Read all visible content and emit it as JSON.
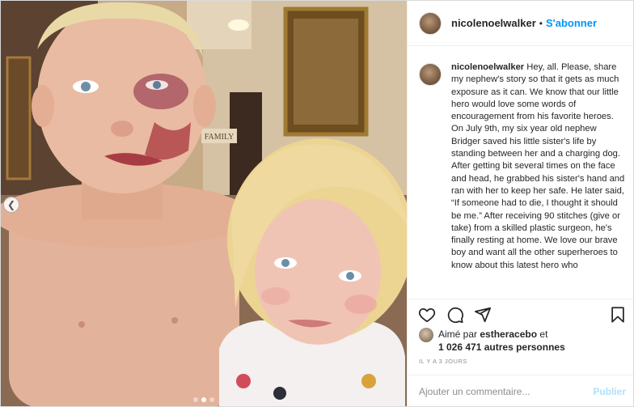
{
  "post": {
    "username": "nicolenoelwalker",
    "separator": "•",
    "follow_label": "S'abonner",
    "caption_username": "nicolenoelwalker",
    "caption_text": "Hey, all. Please, share my nephew's story so that it gets as much exposure as it can. We know that our little hero would love some words of encouragement from his favorite heroes. On July 9th, my six year old nephew Bridger saved his little sister's life by standing between her and a charging dog. After getting bit several times on the face and head, he grabbed his sister's hand and ran with her to keep her safe. He later said, “If someone had to die, I thought it should be me.” After receiving 90 stitches (give or take) from a skilled plastic surgeon, he's finally resting at home. We love our brave boy and want all the other superheroes to know about this latest hero who"
  },
  "photo": {
    "wall_sign": "FAMILY"
  },
  "actions": {
    "like_icon": "heart-icon",
    "comment_icon": "comment-icon",
    "share_icon": "share-icon",
    "save_icon": "bookmark-icon"
  },
  "likes": {
    "prefix": "Aimé par ",
    "first_user": "estheracebo",
    "joiner": " et",
    "count": "1 026 471 autres personnes"
  },
  "time_ago": "IL Y A 3 JOURS",
  "comment": {
    "placeholder": "Ajouter un commentaire...",
    "publish_label": "Publier"
  },
  "carousel": {
    "total_slides": 3,
    "active_slide": 1
  },
  "colors": {
    "accent": "#0095f6",
    "publish_disabled": "#b2dffc",
    "text": "#262626",
    "muted": "#8e8e8e",
    "border": "#efefef"
  }
}
